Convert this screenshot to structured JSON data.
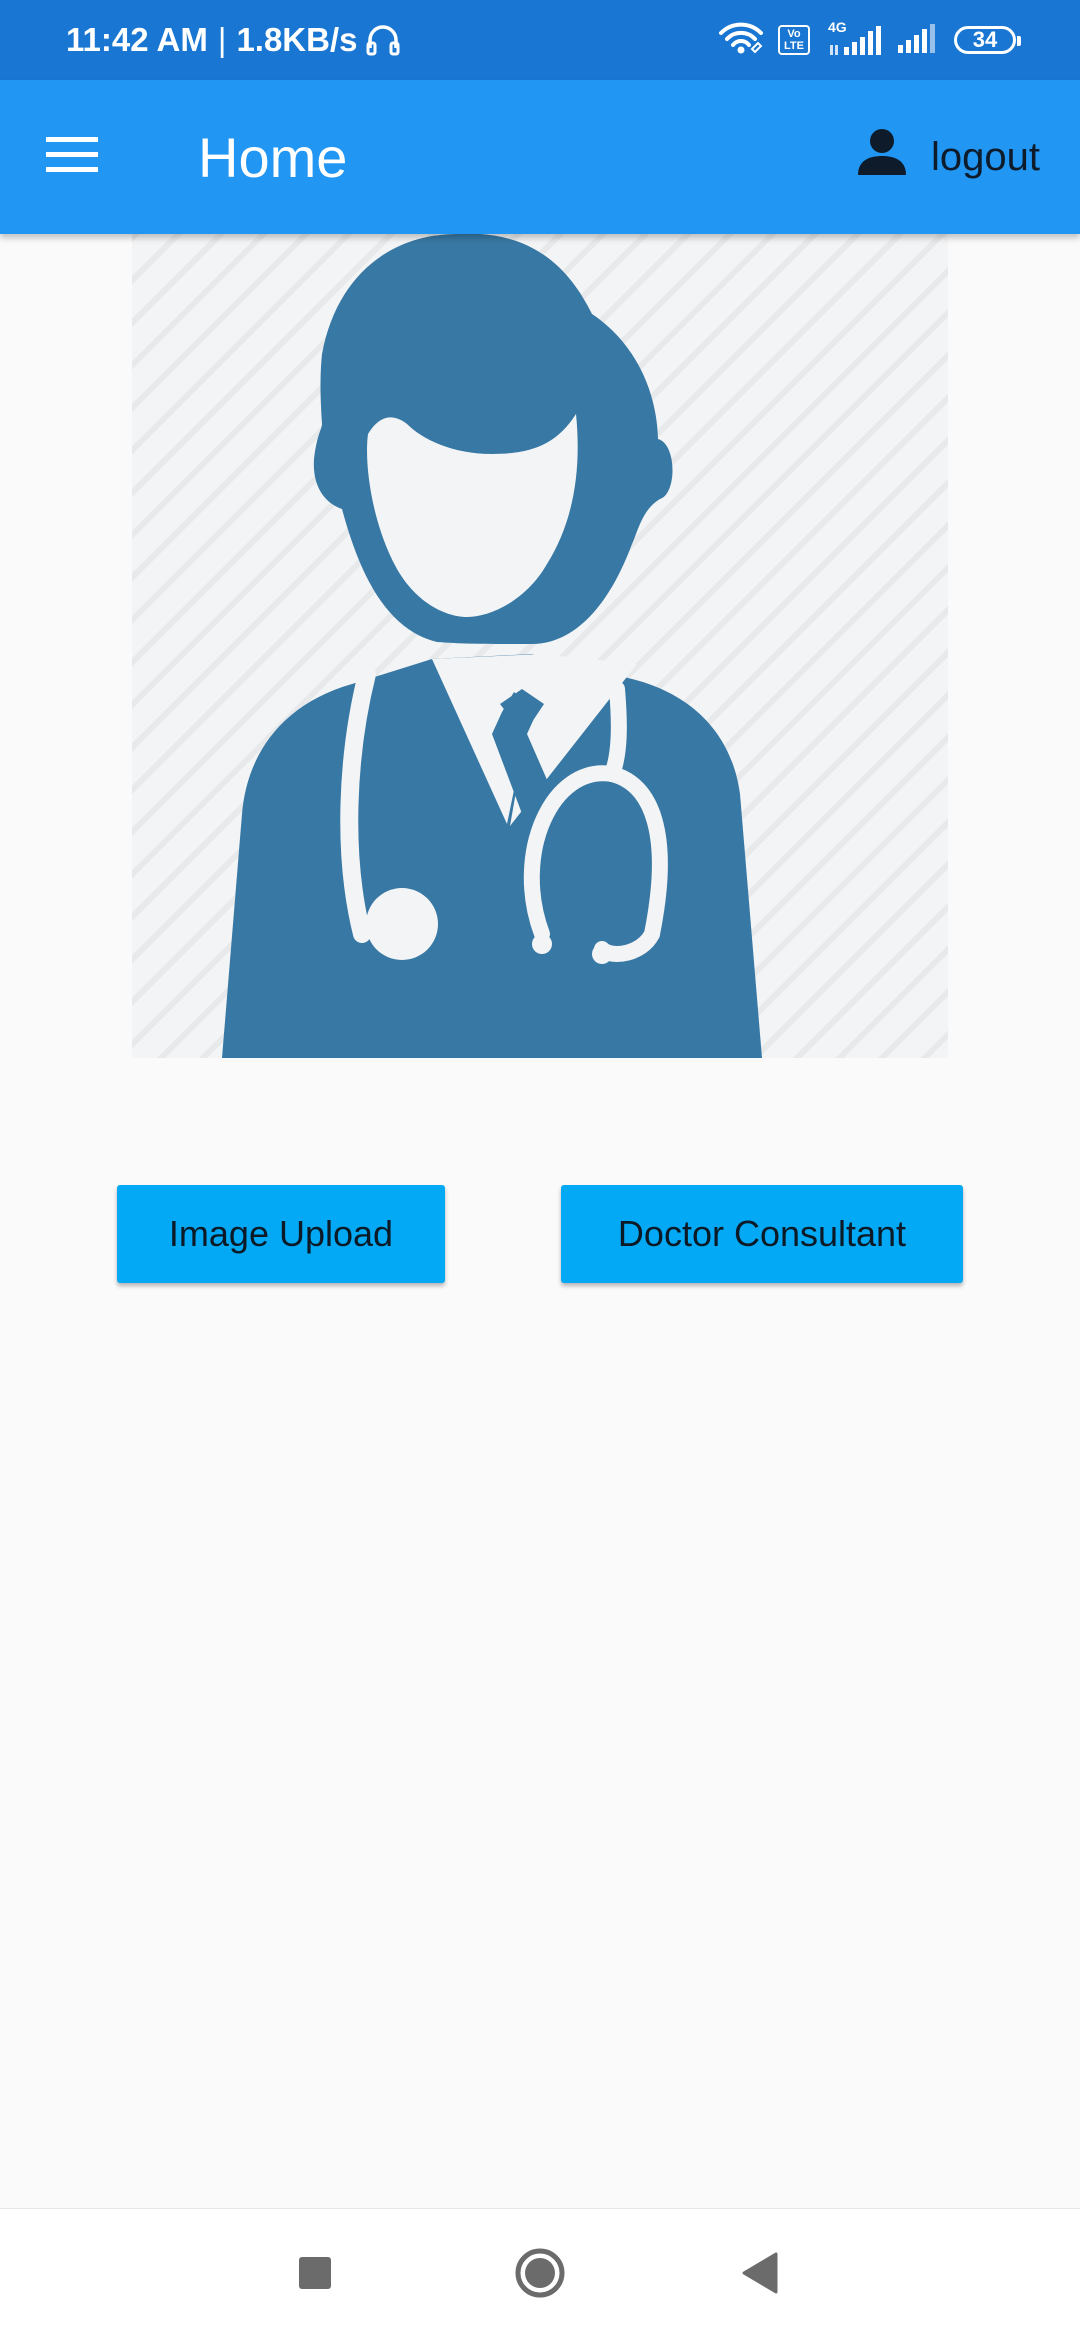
{
  "status_bar": {
    "time": "11:42 AM",
    "separator": "|",
    "network_speed": "1.8KB/s",
    "battery_level": "34",
    "volte_top": "Vo",
    "volte_bottom": "LTE",
    "network_type": "4G",
    "icons": [
      "headset-icon",
      "wifi-icon",
      "volte-icon",
      "signal-icon",
      "signal-icon",
      "battery-icon"
    ]
  },
  "app_bar": {
    "title": "Home",
    "logout_label": "logout",
    "icons": [
      "menu-icon",
      "person-icon"
    ],
    "color": "#2196f3"
  },
  "content": {
    "image": "doctor-illustration",
    "image_color": "#3878a4",
    "buttons": {
      "image_upload": "Image Upload",
      "doctor_consultant": "Doctor Consultant",
      "color": "#03a9f4"
    }
  },
  "nav_bar": {
    "icons": [
      "recents-icon",
      "home-icon",
      "back-icon"
    ]
  }
}
